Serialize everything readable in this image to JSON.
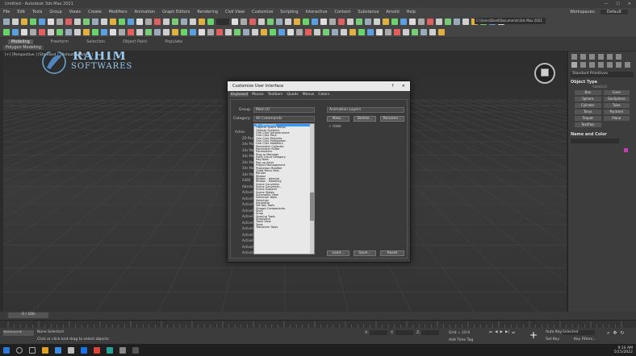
{
  "app": {
    "title": "Untitled - Autodesk 3ds Max 2021",
    "workspace_label": "Workspaces:",
    "workspace_value": "Default"
  },
  "menu": [
    "File",
    "Edit",
    "Tools",
    "Group",
    "Views",
    "Create",
    "Modifiers",
    "Animation",
    "Graph Editors",
    "Rendering",
    "Civil View",
    "Customize",
    "Scripting",
    "Interactive",
    "Content",
    "Substance",
    "Arnold",
    "Help"
  ],
  "toolbar": {
    "path": "C:\\Users\\Devil\\Documents\\3ds Max 2021"
  },
  "ribbon": {
    "tabs": [
      "Modeling",
      "Freeform",
      "Selection",
      "Object Paint",
      "Populate"
    ],
    "active_mode": "Polygon Modeling"
  },
  "viewport": {
    "label": "[+] [Perspective ] [Standard ] [Default Shading ]"
  },
  "watermark": {
    "text1": "RAHIM",
    "text2": "SOFTWARES"
  },
  "command_panel": {
    "dropdown": "Standard Primitives",
    "section_object_type": "Object Type",
    "autogrid": "AutoGrid",
    "objects": [
      "Box",
      "Cone",
      "Sphere",
      "GeoSphere",
      "Cylinder",
      "Tube",
      "Torus",
      "Pyramid",
      "Teapot",
      "Plane",
      "TextPlus"
    ],
    "section_name_color": "Name and Color",
    "accent": "#c63fb0"
  },
  "dialog": {
    "title": "Customize User Interface",
    "help": "?",
    "close": "✕",
    "tabs": [
      "Keyboard",
      "Mouse",
      "Toolbars",
      "Quads",
      "Menus",
      "Colors"
    ],
    "group_label": "Group:",
    "group_value": "Main UI",
    "category_label": "Category:",
    "category_value": "All Commands",
    "action_label": "Actio",
    "behind_items": [
      "Action",
      "2D Pan",
      "3ds Max",
      "3ds Max",
      "3ds Max",
      "3ds Max",
      "3ds Max",
      "3ds Max",
      "A360",
      "Absolute",
      "ActiveS",
      "ActiveS",
      "ActiveS",
      "ActiveS",
      "ActiveS",
      "ActiveS",
      "ActiveS",
      "ActiveS",
      "ActiveS",
      "ActiveShade",
      "ActiveShade Mode"
    ],
    "right_combo": "Animation Layers",
    "new_btn": "New...",
    "delete_btn": "Delete...",
    "rename_btn": "Rename...",
    "hide_label": "Hide",
    "load_btn": "Load...",
    "save_btn": "Save...",
    "reset_btn": "Reset",
    "dropdown_items": [
      "All Commands",
      "Objects Space Warps",
      "Objects Systems",
      "One Click Infrastructure",
      "One Click Pack",
      "One Click Particles",
      "One Click ProBoolean",
      "One Click Modifiers",
      "Parameter Collector",
      "Parameter Editor",
      "Parameters",
      "Plug-in Manager",
      "Point Cloud Category",
      "PolyTools",
      "Pop-up Actor",
      "Project Management",
      "Projection Modifier",
      "Quad Menu Sets",
      "Render",
      "Ribbon",
      "Ribbon - Internal",
      "Ribbon - Modeling",
      "Scene Converter",
      "Scene Converter...",
      "Scene Explorer",
      "Scene States",
      "Schematic View",
      "Selection Tools",
      "Selection",
      "Separator",
      "Set Key Tools",
      "Shapes Components",
      "Shell",
      "Snap",
      "Spacing Tools",
      "Substance",
      "Track View",
      "Tools",
      "Transform Tools"
    ]
  },
  "timeline": {
    "slider": "0 / 100"
  },
  "status": {
    "selection": "None Selected",
    "prompt": "Click or click-and-drag to select objects",
    "maxscript": "MAXScript Mi",
    "x_label": "X:",
    "y_label": "Y:",
    "z_label": "Z:",
    "grid": "Grid = 10.0",
    "add_time_tag": "Add Time Tag",
    "auto_key": "Auto Key",
    "set_key": "Set Key",
    "selected": "Selected",
    "key_filters": "Key Filters..."
  },
  "taskbar": {
    "time": "9:14 AM",
    "date": "5/15/2022"
  }
}
